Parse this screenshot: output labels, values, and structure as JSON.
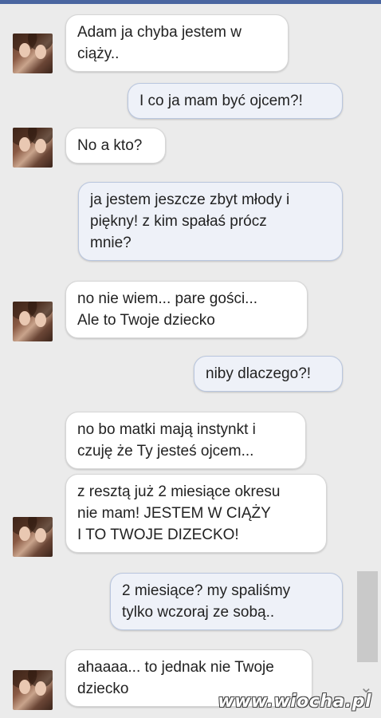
{
  "messages": [
    {
      "side": "in",
      "lines": [
        "Adam ja chyba jestem w",
        "ciąży.."
      ]
    },
    {
      "side": "out",
      "lines": [
        "I co ja mam być ojcem?!"
      ]
    },
    {
      "side": "in",
      "lines": [
        "No a kto?"
      ]
    },
    {
      "side": "out",
      "lines": [
        "ja jestem jeszcze zbyt młody i",
        "piękny! z kim spałaś prócz",
        "mnie?"
      ]
    },
    {
      "side": "in",
      "lines": [
        "no nie wiem... pare gości...",
        "Ale to Twoje dziecko"
      ]
    },
    {
      "side": "out",
      "lines": [
        "niby dlaczego?!"
      ]
    },
    {
      "side": "in",
      "lines": [
        "no bo matki mają instynkt i",
        "czuję że Ty jesteś ojcem..."
      ]
    },
    {
      "side": "in",
      "lines": [
        "z resztą już 2 miesiące okresu",
        "nie mam! JESTEM W CIĄŻY",
        "I TO TWOJE DIZECKO!"
      ]
    },
    {
      "side": "out",
      "lines": [
        "2 miesiące? my spaliśmy",
        "tylko wczoraj ze sobą.."
      ]
    },
    {
      "side": "in",
      "lines": [
        "ahaaaa... to jednak nie Twoje",
        "dziecko"
      ]
    }
  ],
  "watermark": "www.wiocha.pl"
}
